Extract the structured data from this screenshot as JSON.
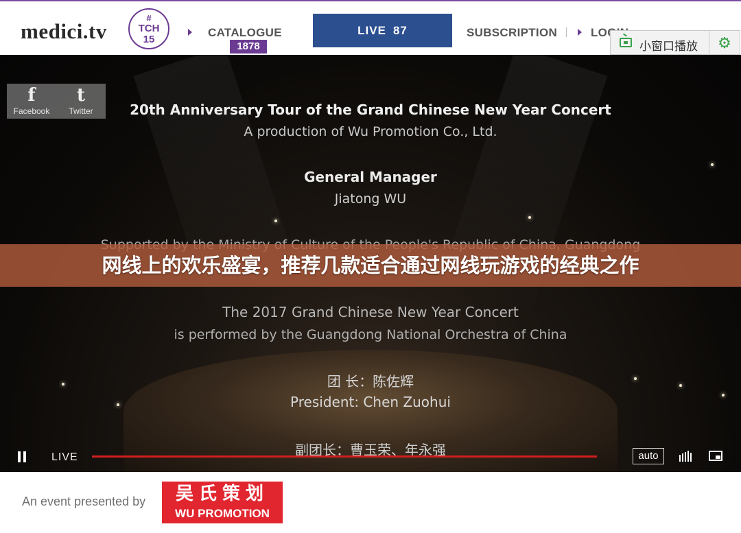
{
  "header": {
    "logo": "medici.tv",
    "badge": {
      "hash": "#",
      "line1": "TCH",
      "line2": "15"
    },
    "nav": {
      "catalogue_label": "CATALOGUE",
      "catalogue_count": "1878",
      "live_label": "LIVE",
      "live_count": "87",
      "subscription_label": "SUBSCRIPTION",
      "login_label": "LOGIN"
    },
    "mini_player": {
      "label": "小窗口播放",
      "icon": "tv-icon",
      "settings_icon": "gear-icon"
    }
  },
  "video": {
    "social": {
      "facebook_glyph": "f",
      "facebook_label": "Facebook",
      "twitter_glyph": "t",
      "twitter_label": "Twitter"
    },
    "credits": {
      "title": "20th Anniversary Tour of the Grand Chinese New Year Concert",
      "production": "A production of Wu Promotion Co., Ltd.",
      "role": "General Manager",
      "name": "Jiatong WU",
      "supported": "Supported by the Ministry of Culture of the People's Republic of China, Guangdong",
      "concert": "The 2017 Grand Chinese New Year Concert",
      "performed": "is performed by the Guangdong National Orchestra of China",
      "president_cn": "团  长：陈佐辉",
      "president_en": "President: Chen Zuohui",
      "vice_cn": "副团长：曹玉荣、年永强"
    },
    "banner_title": "网线上的欢乐盛宴，推荐几款适合通过网线玩游戏的经典之作",
    "controls": {
      "live_label": "LIVE",
      "quality_label": "auto",
      "progress": 1.0,
      "progress_color": "#d21e1e"
    }
  },
  "footer": {
    "event_text": "An event presented by",
    "sponsor_cn": "吴氏策划",
    "sponsor_en": "WU PROMOTION"
  },
  "colors": {
    "brand_purple": "#6b3b93",
    "live_blue": "#2c4f8f",
    "banner": "#b05c3c",
    "sponsor_red": "#e1262f"
  }
}
